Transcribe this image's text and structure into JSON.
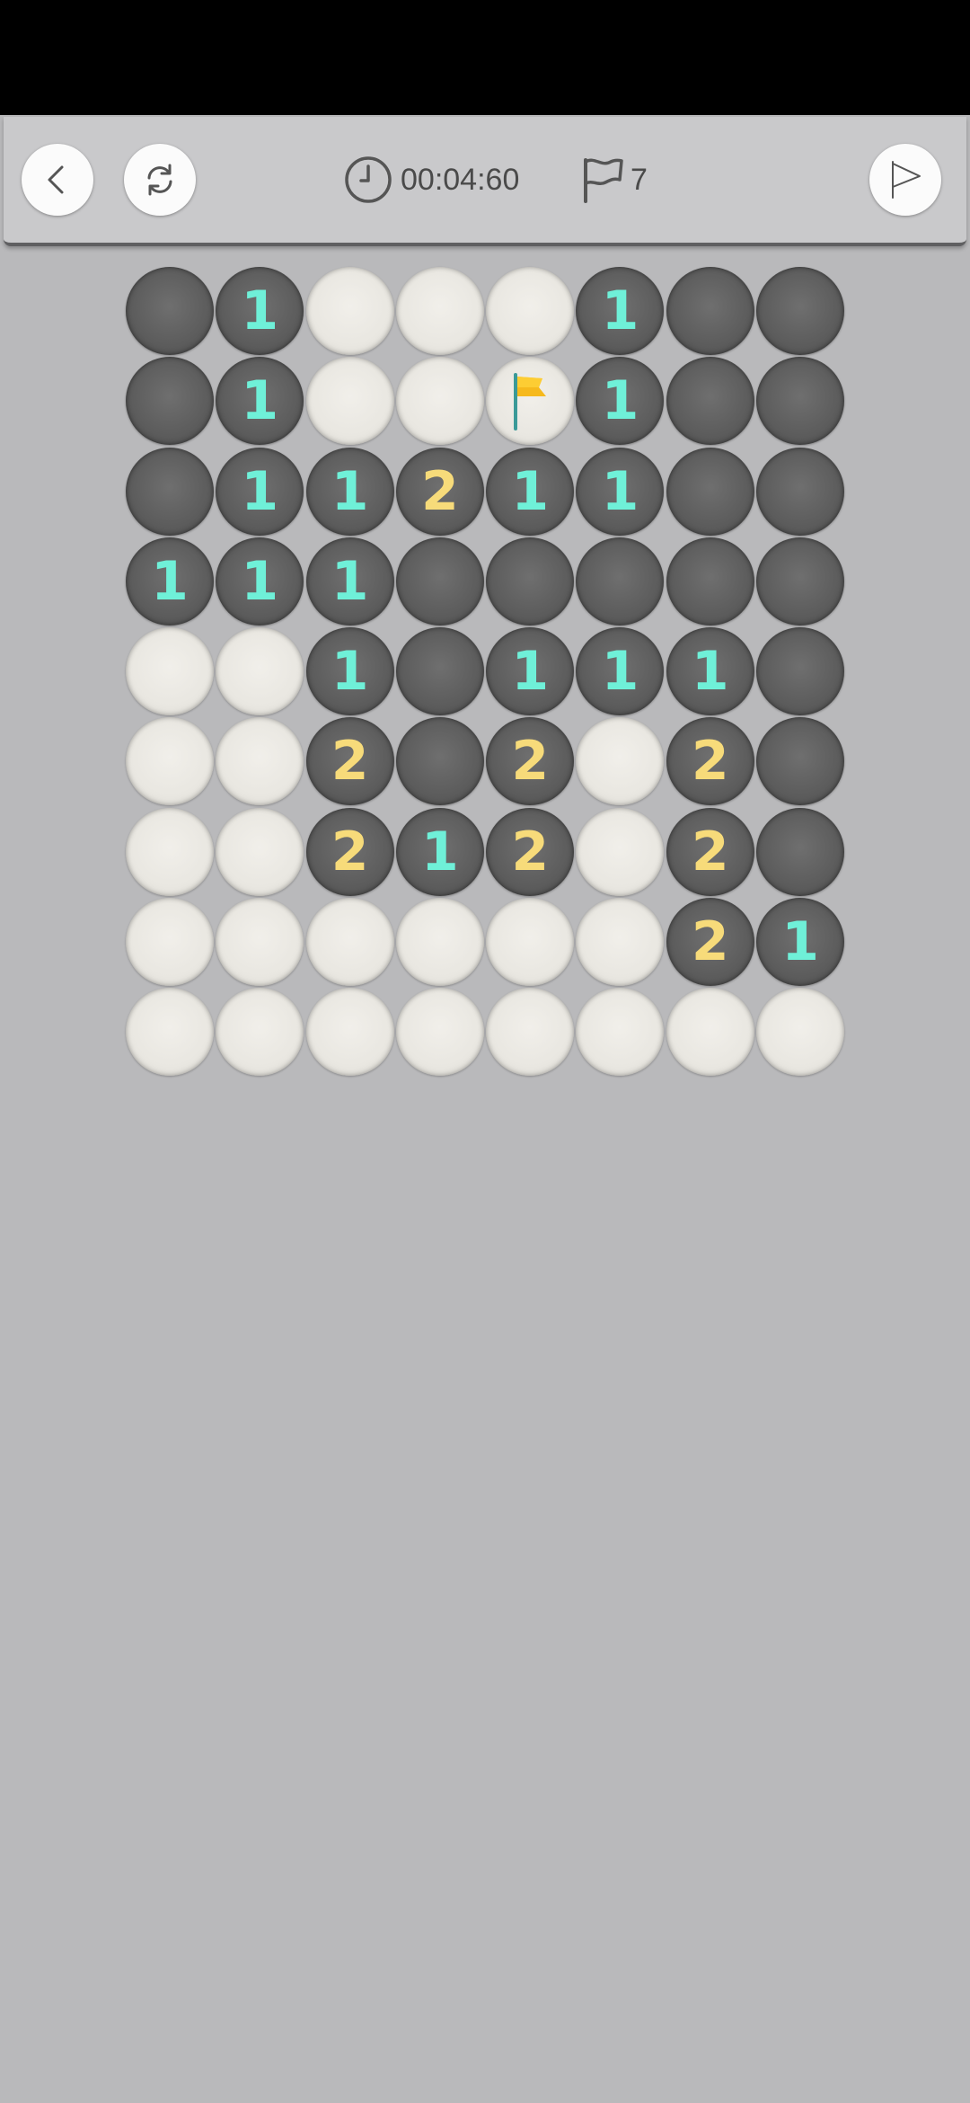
{
  "header": {
    "timer": "00:04:60",
    "flags_remaining": "7"
  },
  "colors": {
    "number_1": "#6ff0d8",
    "number_2": "#f7db7a",
    "flag": "#f6b91c"
  },
  "icons": {
    "back": "chevron-left-icon",
    "restart": "refresh-icon",
    "timer": "clock-icon",
    "flag_counter": "flag-outline-icon",
    "flag_mode": "flag-outline-icon",
    "flag_cell": "flag-icon"
  },
  "board": {
    "rows": 9,
    "cols": 8,
    "cells": [
      [
        "H",
        "1",
        "E",
        "E",
        "E",
        "1",
        "H",
        "H"
      ],
      [
        "H",
        "1",
        "E",
        "E",
        "F",
        "1",
        "H",
        "H"
      ],
      [
        "H",
        "1",
        "1",
        "2",
        "1",
        "1",
        "H",
        "H"
      ],
      [
        "1",
        "1",
        "1",
        "H",
        "H",
        "H",
        "H",
        "H"
      ],
      [
        "E",
        "E",
        "1",
        "H",
        "1",
        "1",
        "1",
        "H"
      ],
      [
        "E",
        "E",
        "2",
        "H",
        "2",
        "E",
        "2",
        "H"
      ],
      [
        "E",
        "E",
        "2",
        "1",
        "2",
        "E",
        "2",
        "H"
      ],
      [
        "E",
        "E",
        "E",
        "E",
        "E",
        "E",
        "2",
        "1"
      ],
      [
        "E",
        "E",
        "E",
        "E",
        "E",
        "E",
        "E",
        "E"
      ]
    ]
  }
}
